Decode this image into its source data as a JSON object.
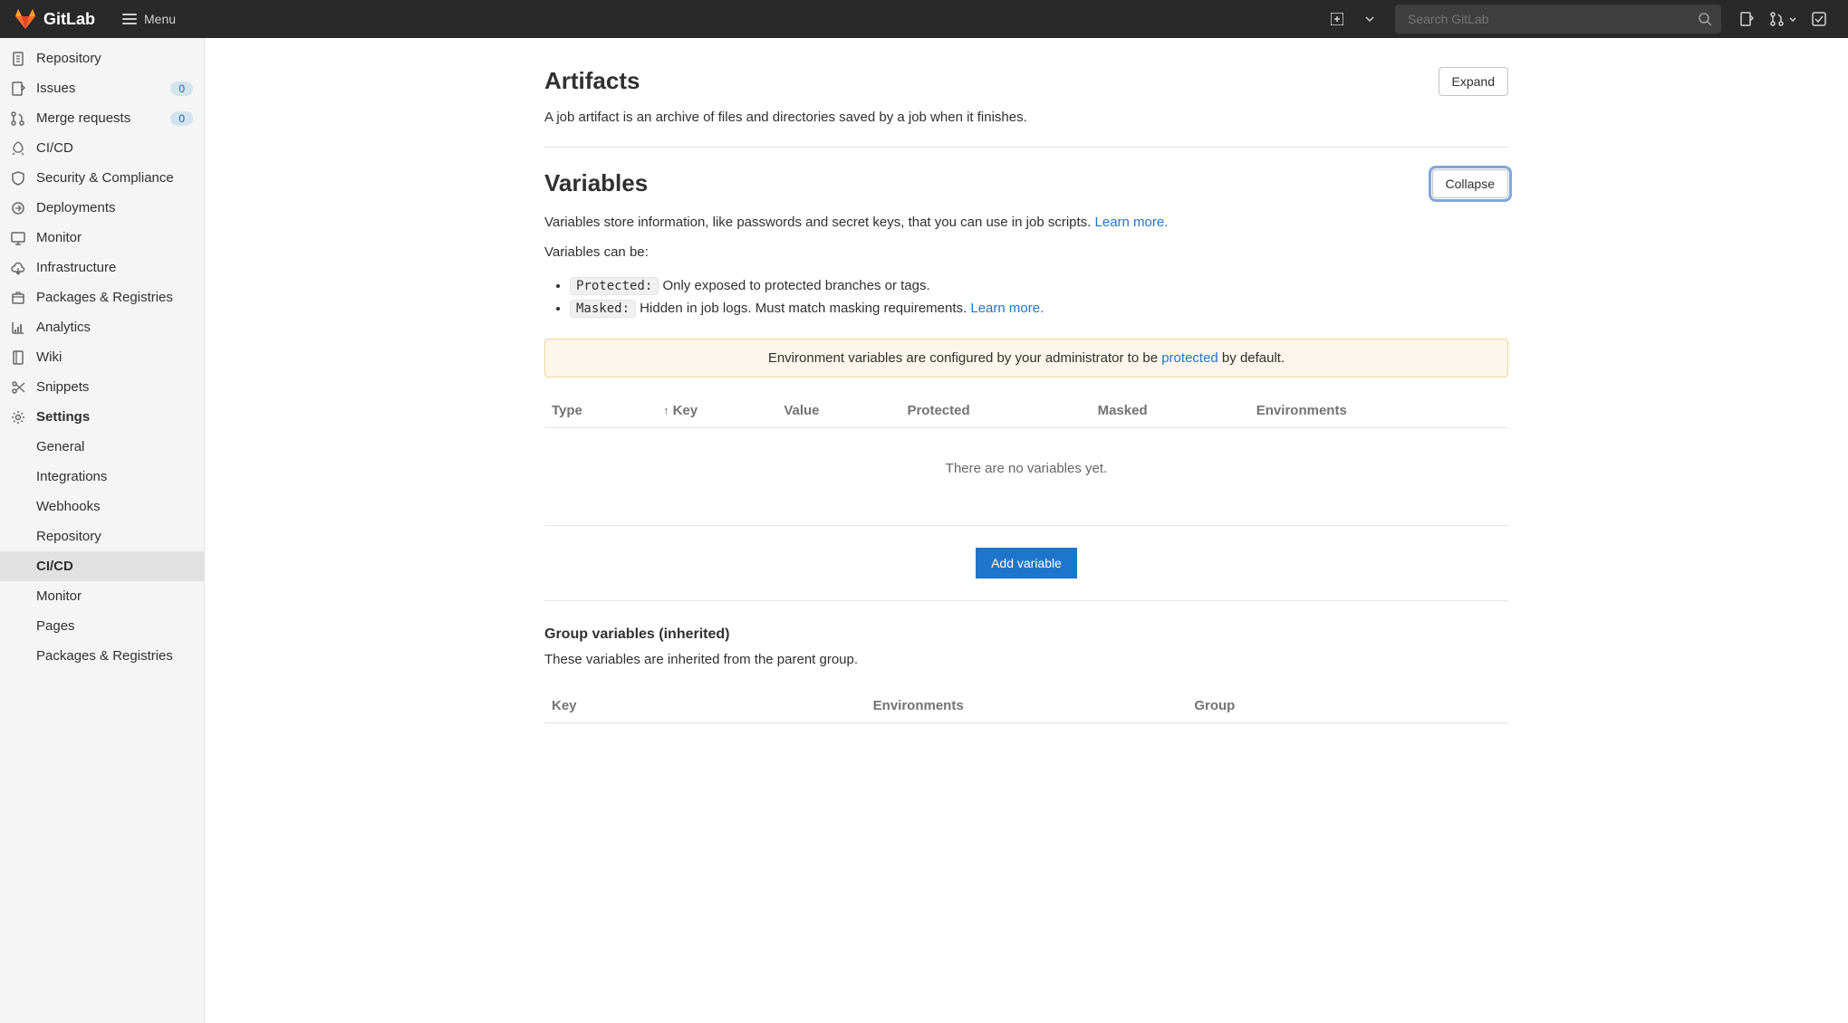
{
  "header": {
    "brand": "GitLab",
    "menu_label": "Menu",
    "search_placeholder": "Search GitLab"
  },
  "sidebar": {
    "items": [
      {
        "label": "Repository",
        "icon": "doc"
      },
      {
        "label": "Issues",
        "icon": "issues",
        "badge": "0"
      },
      {
        "label": "Merge requests",
        "icon": "merge",
        "badge": "0"
      },
      {
        "label": "CI/CD",
        "icon": "rocket"
      },
      {
        "label": "Security & Compliance",
        "icon": "shield"
      },
      {
        "label": "Deployments",
        "icon": "deploy"
      },
      {
        "label": "Monitor",
        "icon": "monitor"
      },
      {
        "label": "Infrastructure",
        "icon": "cloud"
      },
      {
        "label": "Packages & Registries",
        "icon": "package"
      },
      {
        "label": "Analytics",
        "icon": "chart"
      },
      {
        "label": "Wiki",
        "icon": "book"
      },
      {
        "label": "Snippets",
        "icon": "scissors"
      },
      {
        "label": "Settings",
        "icon": "gear",
        "bold": true
      }
    ],
    "settings_sub": [
      "General",
      "Integrations",
      "Webhooks",
      "Repository",
      "CI/CD",
      "Monitor",
      "Pages",
      "Packages & Registries"
    ],
    "active_sub": "CI/CD"
  },
  "artifacts": {
    "title": "Artifacts",
    "desc": "A job artifact is an archive of files and directories saved by a job when it finishes.",
    "button": "Expand"
  },
  "variables": {
    "title": "Variables",
    "button": "Collapse",
    "desc_1": "Variables store information, like passwords and secret keys, that you can use in job scripts. ",
    "learn_more": "Learn more.",
    "can_be": "Variables can be:",
    "protected_tag": "Protected:",
    "protected_text": " Only exposed to protected branches or tags.",
    "masked_tag": "Masked:",
    "masked_text": " Hidden in job logs. Must match masking requirements. ",
    "alert_prefix": "Environment variables are configured by your administrator to be ",
    "alert_link": "protected",
    "alert_suffix": " by default.",
    "columns": [
      "Type",
      "Key",
      "Value",
      "Protected",
      "Masked",
      "Environments"
    ],
    "empty": "There are no variables yet.",
    "add_button": "Add variable"
  },
  "group_vars": {
    "title": "Group variables (inherited)",
    "desc": "These variables are inherited from the parent group.",
    "columns": [
      "Key",
      "Environments",
      "Group"
    ]
  }
}
